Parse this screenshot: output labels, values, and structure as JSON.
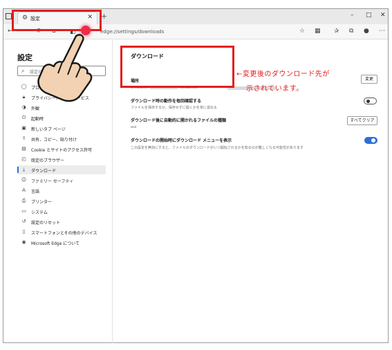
{
  "browser": {
    "tab_title": "設定",
    "url_display": "edge://settings/downloads",
    "window_controls": {
      "minimize": "–",
      "maximize": "□",
      "close": "✕"
    }
  },
  "sidebar": {
    "title": "設定",
    "search_placeholder": "設定の検索",
    "items": [
      {
        "label": "プロファイル",
        "icon": "person-icon"
      },
      {
        "label": "プライバシー、検索、サービス",
        "icon": "lock-icon"
      },
      {
        "label": "外観",
        "icon": "palette-icon"
      },
      {
        "label": "起動時",
        "icon": "power-icon"
      },
      {
        "label": "新しいタブ ページ",
        "icon": "newtab-icon"
      },
      {
        "label": "共有、コピー、貼り付け",
        "icon": "share-icon"
      },
      {
        "label": "Cookie とサイトのアクセス許可",
        "icon": "permissions-icon"
      },
      {
        "label": "既定のブラウザー",
        "icon": "browser-icon"
      },
      {
        "label": "ダウンロード",
        "icon": "download-icon",
        "active": true
      },
      {
        "label": "ファミリー セーフティ",
        "icon": "family-icon"
      },
      {
        "label": "言語",
        "icon": "language-icon"
      },
      {
        "label": "プリンター",
        "icon": "printer-icon"
      },
      {
        "label": "システム",
        "icon": "system-icon"
      },
      {
        "label": "設定のリセット",
        "icon": "reset-icon"
      },
      {
        "label": "スマートフォンとその他のデバイス",
        "icon": "phone-icon"
      },
      {
        "label": "Microsoft Edge について",
        "icon": "edge-icon"
      }
    ]
  },
  "main": {
    "title": "ダウンロード",
    "location": {
      "label": "場所",
      "path": "C:¥Users¥",
      "path_tail": "¥OneDrive",
      "change_button": "変更"
    },
    "ask": {
      "label": "ダウンロード時の動作を毎回確認する",
      "sub": "ファイルを保存するか、保存せずに開くかを常に尋ねる",
      "enabled": false
    },
    "auto_open": {
      "label": "ダウンロード後に自動的に開かれるファイルの種類",
      "sub": "asx",
      "clear_button": "すべてクリア"
    },
    "show_menu": {
      "label": "ダウンロードの開始時にダウンロード メニューを表示",
      "sub": "この設定を無効にすると、ファイルのダウンロードがいつ開始されるかを知るのが難しくなる可能性があります",
      "enabled": true
    }
  },
  "annotation": {
    "line1": "←変更後のダウンロード先が",
    "line2": "示されています。",
    "color": "#e31c1c"
  }
}
